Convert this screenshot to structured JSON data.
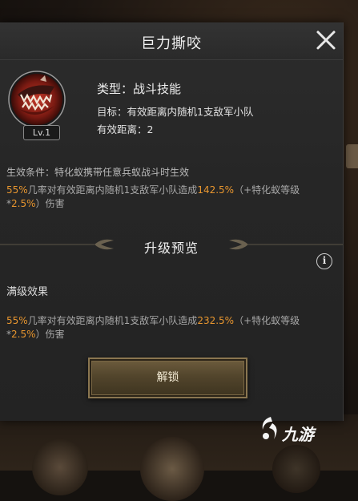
{
  "dialog": {
    "title": "巨力撕咬",
    "close_icon": "close-icon"
  },
  "skill": {
    "icon": "creature-mouth-icon",
    "level": "Lv.1",
    "type": "类型：战斗技能",
    "target": "目标：有效距离内随机1支敌军小队",
    "range": "有效距离：2"
  },
  "effect": {
    "condition": "生效条件：特化蚁携带任意兵蚁战斗时生效",
    "part1": "55%",
    "part2": "几率对有效距离内随机1支敌军小队造成",
    "part3": "142.5%",
    "part4": "（+特化蚁等级*",
    "part5": "2.5%",
    "part6": "）伤害"
  },
  "upgrade": {
    "title": "升级预览",
    "info_icon": "info-icon",
    "max_title": "满级效果",
    "max_part1": "55%",
    "max_part2": "几率对有效距离内随机1支敌军小队造成",
    "max_part3": "232.5%",
    "max_part4": "（+特化蚁等级*",
    "max_part5": "2.5%",
    "max_part6": "）伤害"
  },
  "actions": {
    "unlock_label": "解锁"
  },
  "watermark": {
    "text": "九游"
  },
  "colors": {
    "accent_orange": "#e8962f",
    "panel_bg": "#282828",
    "button_gold": "#6e5d3e"
  }
}
